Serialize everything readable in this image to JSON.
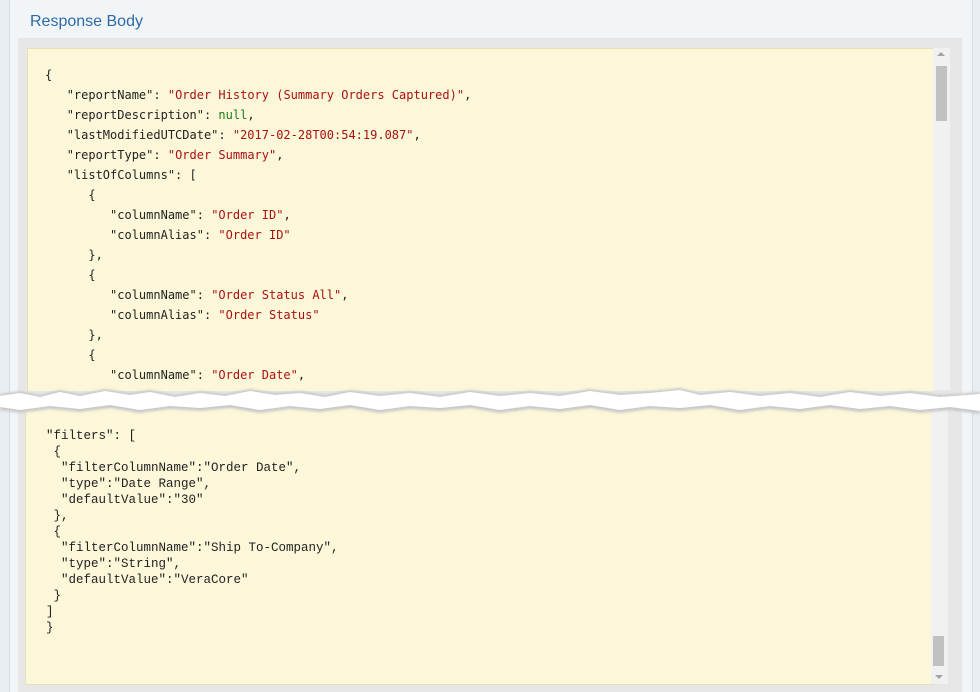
{
  "panel": {
    "title": "Response Body"
  },
  "top_json": [
    {
      "indent": 0,
      "parts": [
        [
          "k",
          "{"
        ]
      ]
    },
    {
      "indent": 1,
      "parts": [
        [
          "k",
          "\"reportName\": "
        ],
        [
          "s",
          "\"Order History (Summary Orders Captured)\""
        ],
        [
          "k",
          ","
        ]
      ]
    },
    {
      "indent": 1,
      "parts": [
        [
          "k",
          "\"reportDescription\": "
        ],
        [
          "n",
          "null"
        ],
        [
          "k",
          ","
        ]
      ]
    },
    {
      "indent": 1,
      "parts": [
        [
          "k",
          "\"lastModifiedUTCDate\": "
        ],
        [
          "s",
          "\"2017-02-28T00:54:19.087\""
        ],
        [
          "k",
          ","
        ]
      ]
    },
    {
      "indent": 1,
      "parts": [
        [
          "k",
          "\"reportType\": "
        ],
        [
          "s",
          "\"Order Summary\""
        ],
        [
          "k",
          ","
        ]
      ]
    },
    {
      "indent": 1,
      "parts": [
        [
          "k",
          "\"listOfColumns\": ["
        ]
      ]
    },
    {
      "indent": 2,
      "parts": [
        [
          "k",
          "{"
        ]
      ]
    },
    {
      "indent": 3,
      "parts": [
        [
          "k",
          "\"columnName\": "
        ],
        [
          "s",
          "\"Order ID\""
        ],
        [
          "k",
          ","
        ]
      ]
    },
    {
      "indent": 3,
      "parts": [
        [
          "k",
          "\"columnAlias\": "
        ],
        [
          "s",
          "\"Order ID\""
        ]
      ]
    },
    {
      "indent": 2,
      "parts": [
        [
          "k",
          "},"
        ]
      ]
    },
    {
      "indent": 2,
      "parts": [
        [
          "k",
          "{"
        ]
      ]
    },
    {
      "indent": 3,
      "parts": [
        [
          "k",
          "\"columnName\": "
        ],
        [
          "s",
          "\"Order Status All\""
        ],
        [
          "k",
          ","
        ]
      ]
    },
    {
      "indent": 3,
      "parts": [
        [
          "k",
          "\"columnAlias\": "
        ],
        [
          "s",
          "\"Order Status\""
        ]
      ]
    },
    {
      "indent": 2,
      "parts": [
        [
          "k",
          "},"
        ]
      ]
    },
    {
      "indent": 2,
      "parts": [
        [
          "k",
          "{"
        ]
      ]
    },
    {
      "indent": 3,
      "parts": [
        [
          "k",
          "\"columnName\": "
        ],
        [
          "s",
          "\"Order Date\""
        ],
        [
          "k",
          ","
        ]
      ]
    }
  ],
  "bottom_json": [
    "\"filters\": [",
    " {",
    "  \"filterColumnName\":\"Order Date\",",
    "  \"type\":\"Date Range\",",
    "  \"defaultValue\":\"30\"",
    " },",
    " {",
    "  \"filterColumnName\":\"Ship To-Company\",",
    "  \"type\":\"String\",",
    "  \"defaultValue\":\"VeraCore\"",
    " }",
    "]",
    "}"
  ]
}
